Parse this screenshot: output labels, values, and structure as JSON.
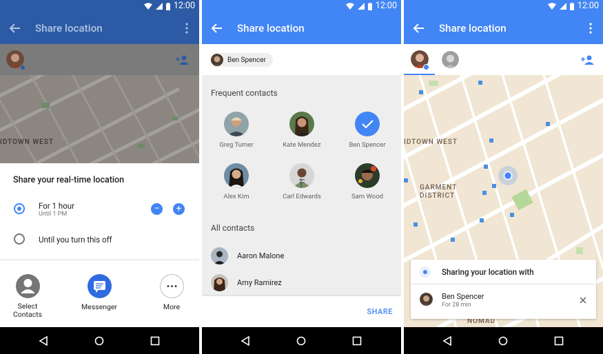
{
  "status_bar": {
    "time": "12:00"
  },
  "screen1": {
    "title": "Share location",
    "sheet_title": "Share your real-time location",
    "option1_label": "For 1 hour",
    "option1_sub": "Until 1 PM",
    "option2_label": "Until you turn this off",
    "map_label": "IDTOWN WEST",
    "minus": "−",
    "plus": "+",
    "apps": [
      {
        "label": "Select\nContacts",
        "icon": "person-icon"
      },
      {
        "label": "Messenger",
        "icon": "messenger-icon"
      },
      {
        "label": "More",
        "icon": "more-icon"
      }
    ]
  },
  "screen2": {
    "title": "Share location",
    "chip_name": "Ben Spencer",
    "frequent_title": "Frequent contacts",
    "frequent": [
      {
        "name": "Greg Turner"
      },
      {
        "name": "Kate Mendez"
      },
      {
        "name": "Ben Spencer",
        "selected": true
      },
      {
        "name": "Alex Kim"
      },
      {
        "name": "Carl Edwards"
      },
      {
        "name": "Sam Wood"
      }
    ],
    "all_title": "All contacts",
    "all": [
      {
        "name": "Aaron Malone"
      },
      {
        "name": "Amy Ramirez"
      }
    ],
    "share_label": "SHARE"
  },
  "screen3": {
    "title": "Share location",
    "map_label_1": "IDTOWN WEST",
    "map_label_2": "GARMENT",
    "map_label_3": "DISTRICT",
    "map_label_4": "NOMAD",
    "sharing_with": "Sharing your location with",
    "person_name": "Ben Spencer",
    "person_duration": "For 28 min"
  },
  "colors": {
    "accent": "#4285f4",
    "dim_accent": "#2c5aa4",
    "map": "#f1e6d3"
  }
}
